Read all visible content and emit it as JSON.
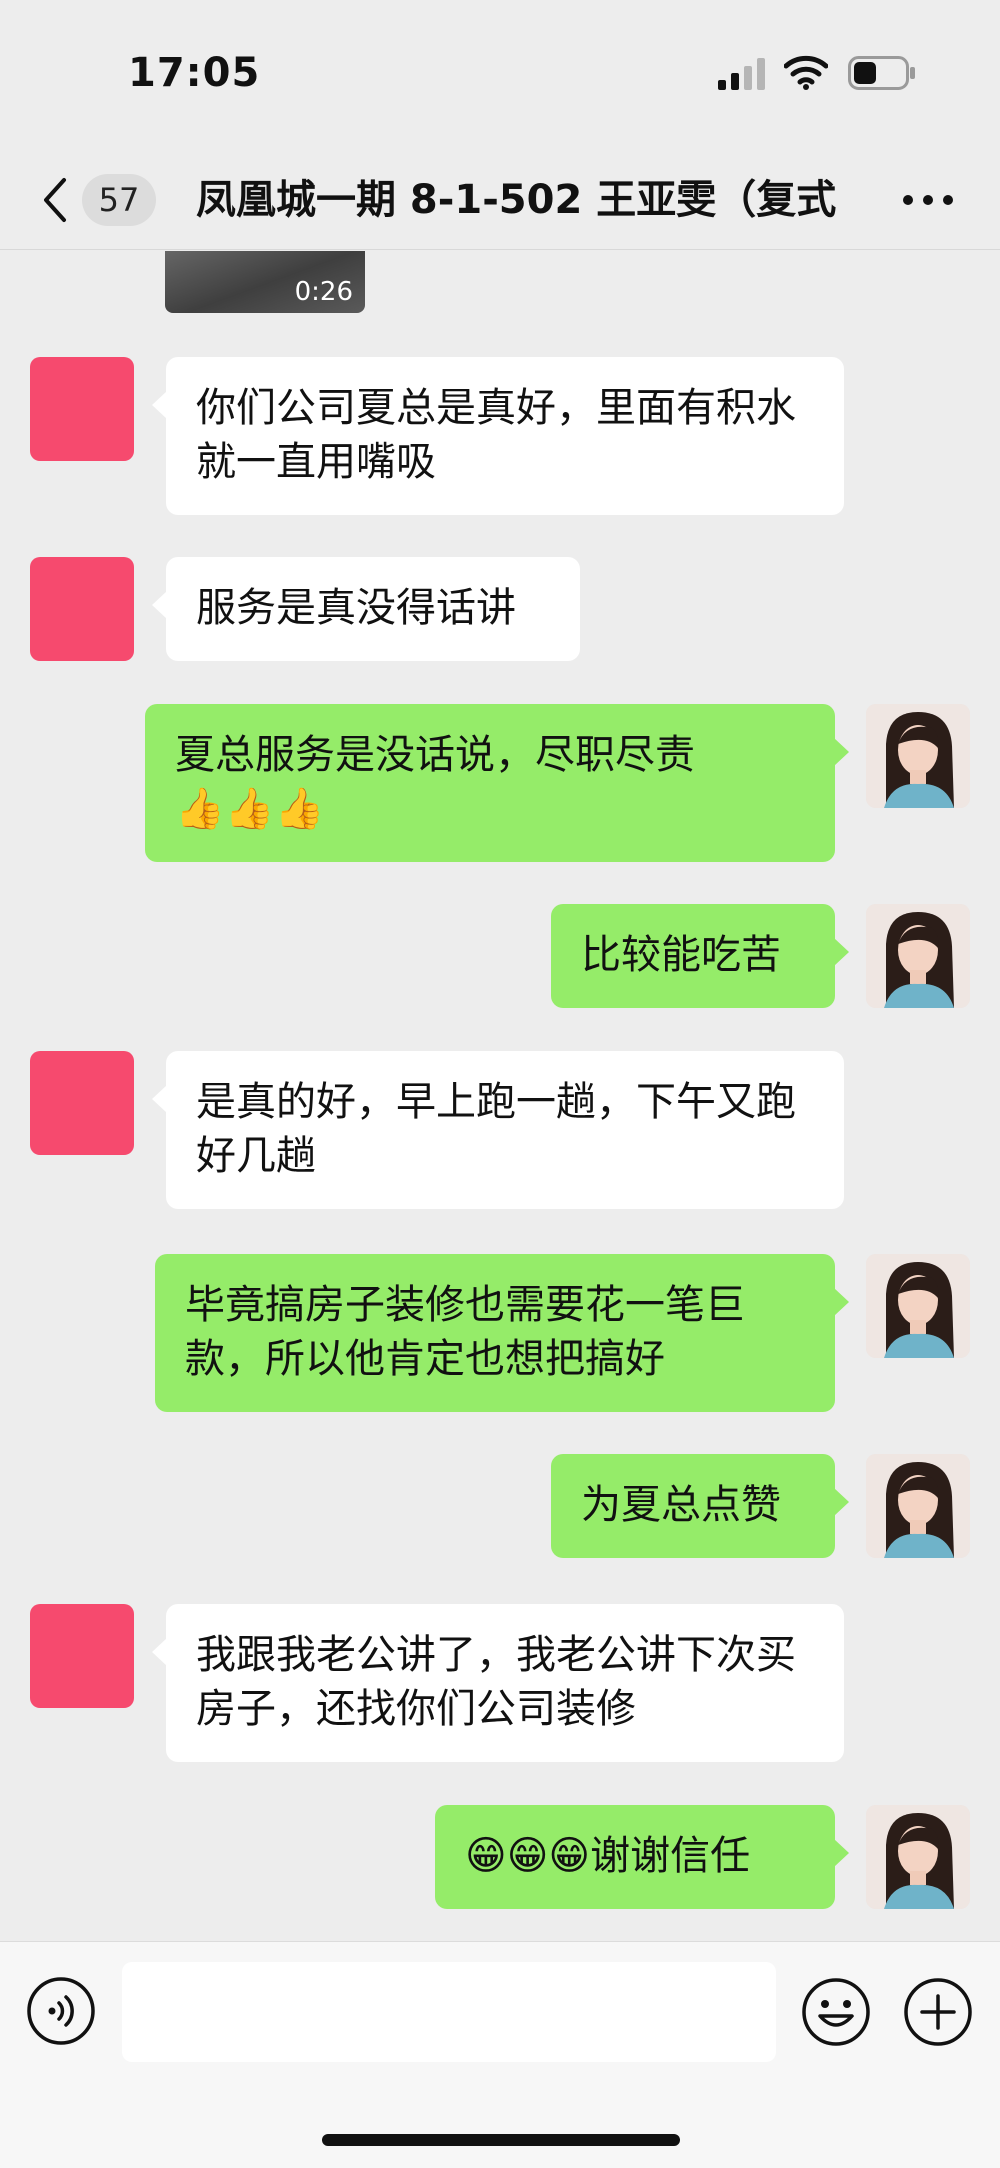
{
  "status_bar": {
    "time": "17:05",
    "signal_icon": "cellular-signal-icon",
    "wifi_icon": "wifi-icon",
    "battery_icon": "battery-icon"
  },
  "nav": {
    "back_icon": "chevron-left-icon",
    "unread_count": "57",
    "title": "凤凰城一期 8-1-502 王亚雯（复式",
    "more_icon": "more-dots-icon"
  },
  "video": {
    "duration": "0:26"
  },
  "messages": [
    {
      "side": "left",
      "text": "你们公司夏总是真好，里面有积水就一直用嘴吸"
    },
    {
      "side": "left",
      "text": "服务是真没得话讲"
    },
    {
      "side": "right",
      "text": "夏总服务是没话说，尽职尽责",
      "emoji": "👍👍👍"
    },
    {
      "side": "right",
      "text": "比较能吃苦"
    },
    {
      "side": "left",
      "text": "是真的好，早上跑一趟，下午又跑好几趟"
    },
    {
      "side": "right",
      "text": "毕竟搞房子装修也需要花一笔巨款，所以他肯定也想把搞好"
    },
    {
      "side": "right",
      "text": "为夏总点赞"
    },
    {
      "side": "left",
      "text": "我跟我老公讲了，我老公讲下次买房子，还找你们公司装修"
    },
    {
      "side": "right",
      "emoji": "😁😁😁",
      "text": "谢谢信任"
    }
  ],
  "colors": {
    "background": "#ededed",
    "bubble_self": "#95ec69",
    "bubble_other": "#ffffff",
    "avatar_other": "#f64a6e"
  },
  "input_bar": {
    "voice_icon": "voice-icon",
    "message_placeholder": "",
    "emoji_icon": "emoji-icon",
    "plus_icon": "plus-circle-icon"
  }
}
